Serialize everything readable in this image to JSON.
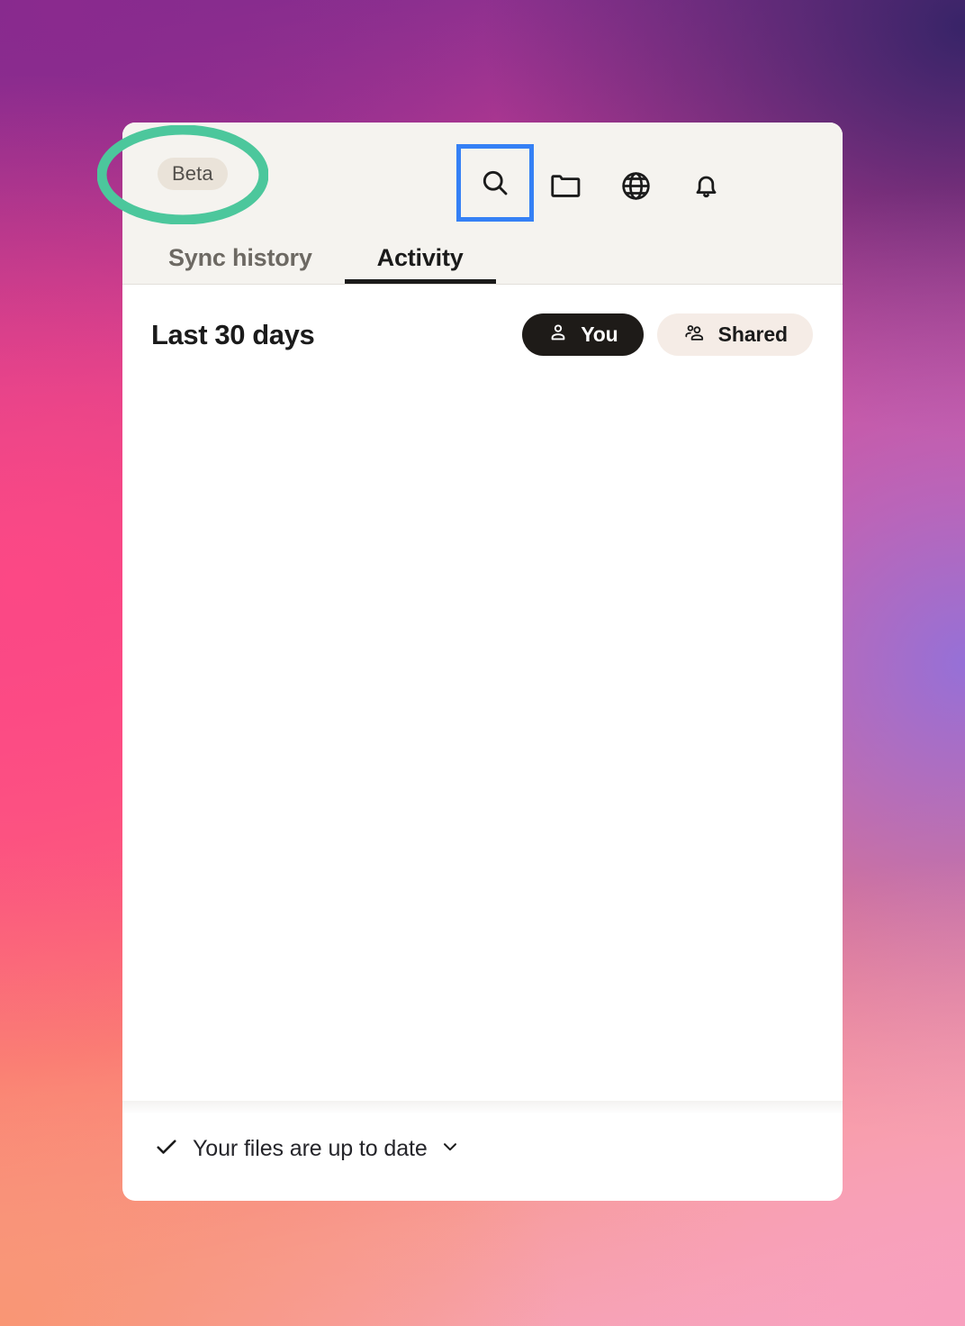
{
  "window": {
    "header": {
      "beta_badge": "Beta",
      "icons": [
        {
          "name": "search-icon",
          "label": "Search",
          "highlighted": true
        },
        {
          "name": "folder-icon",
          "label": "Files",
          "highlighted": false
        },
        {
          "name": "globe-icon",
          "label": "Dropbox.com",
          "highlighted": false
        },
        {
          "name": "bell-icon",
          "label": "Notifications",
          "highlighted": false
        }
      ],
      "tabs": [
        {
          "label": "Sync history",
          "active": false
        },
        {
          "label": "Activity",
          "active": true
        }
      ]
    },
    "content": {
      "section_title": "Last 30 days",
      "filters": [
        {
          "label": "You",
          "icon": "person-icon",
          "active": true
        },
        {
          "label": "Shared",
          "icon": "people-icon",
          "active": false
        }
      ],
      "activity_items": []
    },
    "status_bar": {
      "icon": "checkmark-icon",
      "text": "Your files are up to date",
      "chevron": "chevron-down-icon"
    }
  },
  "annotations": {
    "ellipse": {
      "target": "beta-badge",
      "color": "#4cc79c"
    },
    "box": {
      "target": "search-icon",
      "color": "#3580f5"
    }
  },
  "colors": {
    "header_bg": "#f5f3ef",
    "content_bg": "#ffffff",
    "badge_bg": "#eae3d9",
    "pill_active_bg": "#1e1b18",
    "pill_idle_bg": "#f5ece6",
    "text_primary": "#1b1b1b",
    "text_muted": "#6d6963",
    "annotation_green": "#4cc79c",
    "annotation_blue": "#3580f5"
  }
}
